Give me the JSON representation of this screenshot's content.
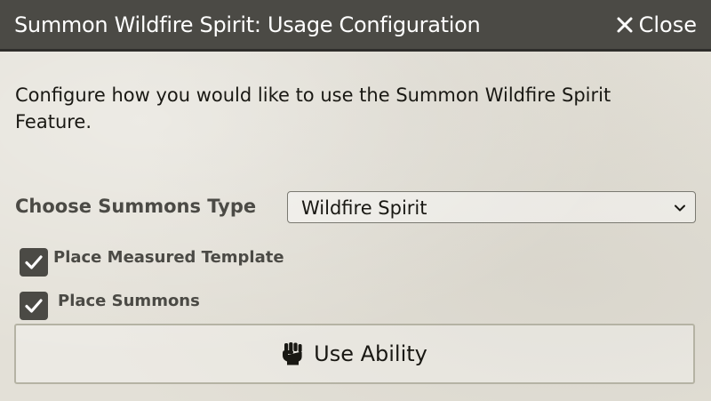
{
  "window": {
    "title": "Summon Wildfire Spirit: Usage Configuration",
    "close_label": "Close"
  },
  "description": "Configure how you would like to use the Summon Wildfire Spirit Feature.",
  "summons": {
    "label": "Choose Summons Type",
    "selected_value": "Wildfire Spirit"
  },
  "options": [
    {
      "label": "Place Measured Template",
      "checked": true
    },
    {
      "label": "Place Summons",
      "checked": true
    }
  ],
  "submit": {
    "label": "Use Ability",
    "icon": "fist-raised-icon"
  },
  "colors": {
    "titlebar": "#4b4a45",
    "background": "#e3e0d7",
    "checkbox": "#4b4a45"
  }
}
